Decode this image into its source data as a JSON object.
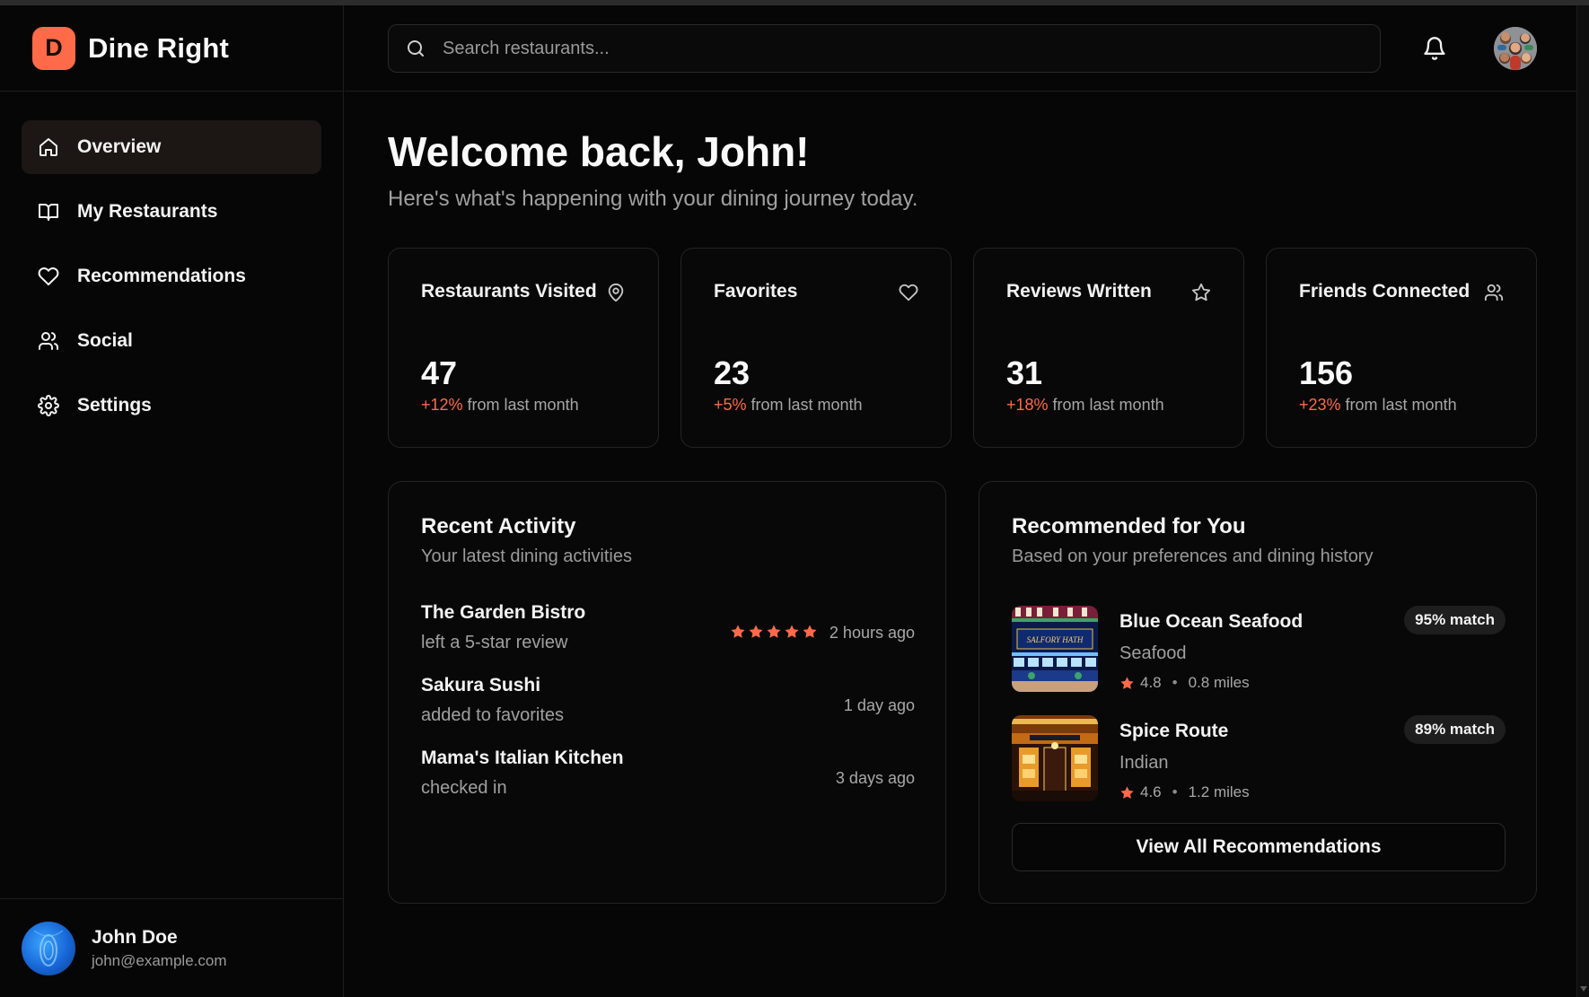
{
  "app": {
    "logo_letter": "D",
    "name": "Dine Right"
  },
  "sidebar": {
    "items": [
      {
        "label": "Overview",
        "icon": "home-icon",
        "active": true
      },
      {
        "label": "My Restaurants",
        "icon": "book-open-icon",
        "active": false
      },
      {
        "label": "Recommendations",
        "icon": "heart-icon",
        "active": false
      },
      {
        "label": "Social",
        "icon": "users-icon",
        "active": false
      },
      {
        "label": "Settings",
        "icon": "gear-icon",
        "active": false
      }
    ],
    "user": {
      "name": "John Doe",
      "email": "john@example.com"
    }
  },
  "header": {
    "search_placeholder": "Search restaurants...",
    "search_value": ""
  },
  "main": {
    "welcome": "Welcome back, John!",
    "subtitle": "Here's what's happening with your dining journey today.",
    "stats": [
      {
        "title": "Restaurants Visited",
        "icon": "map-pin-icon",
        "value": "47",
        "change": "+12%",
        "change_suffix": " from last month"
      },
      {
        "title": "Favorites",
        "icon": "heart-icon",
        "value": "23",
        "change": "+5%",
        "change_suffix": " from last month"
      },
      {
        "title": "Reviews Written",
        "icon": "star-icon",
        "value": "31",
        "change": "+18%",
        "change_suffix": " from last month"
      },
      {
        "title": "Friends Connected",
        "icon": "users-icon",
        "value": "156",
        "change": "+23%",
        "change_suffix": " from last month"
      }
    ],
    "recent_activity": {
      "title": "Recent Activity",
      "subtitle": "Your latest dining activities",
      "items": [
        {
          "name": "The Garden Bistro",
          "desc": "left a 5-star review",
          "time": "2 hours ago",
          "stars": 5
        },
        {
          "name": "Sakura Sushi",
          "desc": "added to favorites",
          "time": "1 day ago",
          "stars": 0
        },
        {
          "name": "Mama's Italian Kitchen",
          "desc": "checked in",
          "time": "3 days ago",
          "stars": 0
        }
      ]
    },
    "recommended": {
      "title": "Recommended for You",
      "subtitle": "Based on your preferences and dining history",
      "items": [
        {
          "name": "Blue Ocean Seafood",
          "cuisine": "Seafood",
          "rating": "4.8",
          "distance": "0.8 miles",
          "match": "95% match",
          "sign_text": "SALFORY HATH"
        },
        {
          "name": "Spice Route",
          "cuisine": "Indian",
          "rating": "4.6",
          "distance": "1.2 miles",
          "match": "89% match"
        }
      ],
      "view_all_label": "View All Recommendations"
    }
  },
  "colors": {
    "accent": "#ff6a48",
    "background": "#060606",
    "card": "#080808",
    "border": "#242424"
  }
}
